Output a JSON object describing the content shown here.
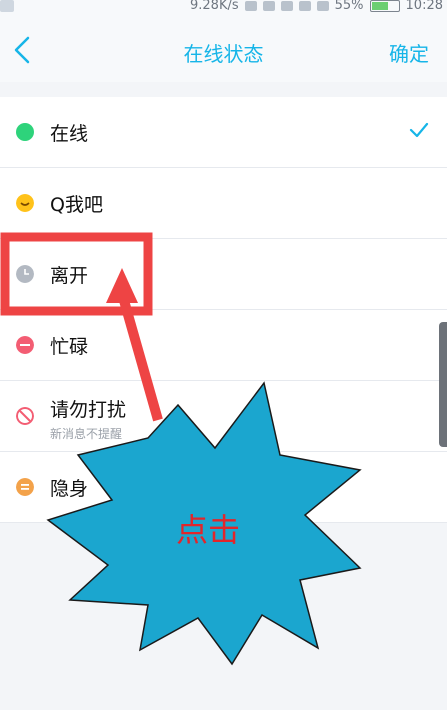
{
  "status_bar": {
    "speed": "9.28K/s",
    "battery": "55%",
    "time": "10:28"
  },
  "header": {
    "title": "在线状态",
    "confirm": "确定"
  },
  "statuses": [
    {
      "label": "在线",
      "color": "#2ed37b",
      "selected": true
    },
    {
      "label": "Q我吧",
      "color": "#ffc21a"
    },
    {
      "label": "离开",
      "color": "#b3b9c2"
    },
    {
      "label": "忙碌",
      "color": "#f35d73"
    },
    {
      "label": "请勿打扰",
      "sub": "新消息不提醒",
      "color": "#f35d73"
    },
    {
      "label": "隐身",
      "color": "#f3a24a"
    }
  ],
  "annotation": {
    "text": "点击",
    "burst_color": "#1ba6cf",
    "arrow_color": "#ee4444"
  }
}
